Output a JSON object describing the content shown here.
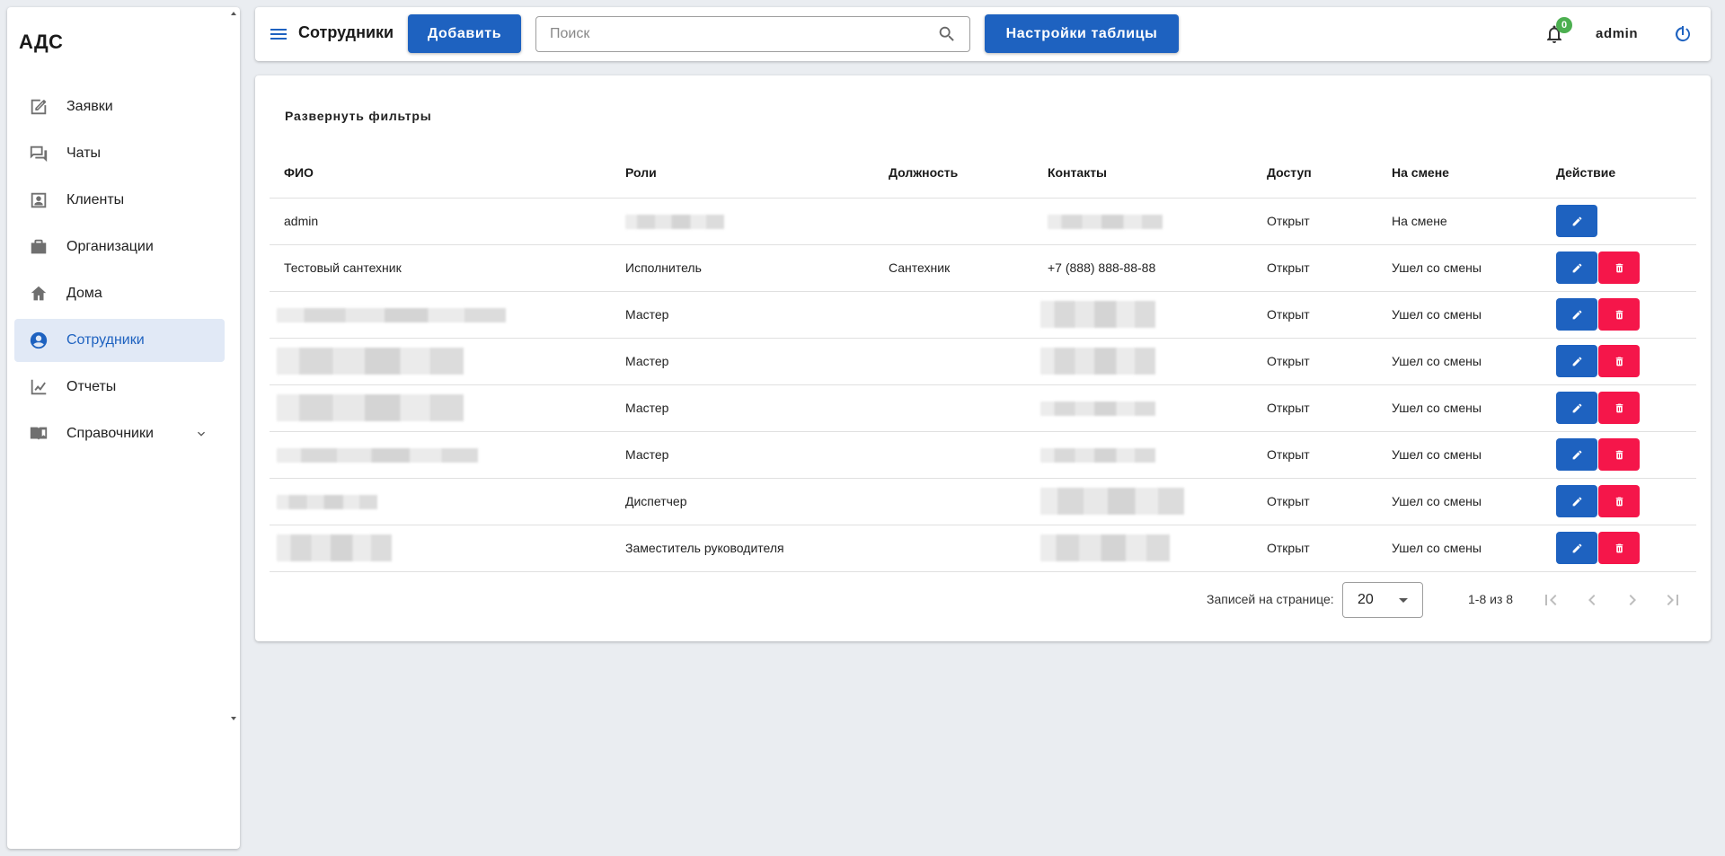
{
  "app": {
    "title": "АДС"
  },
  "sidebar": {
    "items": [
      {
        "label": "Заявки",
        "icon": "edit-note-icon",
        "active": false
      },
      {
        "label": "Чаты",
        "icon": "chat-icon",
        "active": false
      },
      {
        "label": "Клиенты",
        "icon": "contact-card-icon",
        "active": false
      },
      {
        "label": "Организации",
        "icon": "briefcase-icon",
        "active": false
      },
      {
        "label": "Дома",
        "icon": "home-icon",
        "active": false
      },
      {
        "label": "Сотрудники",
        "icon": "account-circle-icon",
        "active": true
      },
      {
        "label": "Отчеты",
        "icon": "line-chart-icon",
        "active": false
      },
      {
        "label": "Справочники",
        "icon": "book-icon",
        "active": false,
        "expandable": true
      }
    ]
  },
  "header": {
    "title": "Сотрудники",
    "add_label": "Добавить",
    "search_placeholder": "Поиск",
    "search_value": "",
    "table_settings_label": "Настройки таблицы",
    "notifications_count": "0",
    "user": "admin"
  },
  "filters": {
    "toggle_label": "Развернуть фильтры"
  },
  "table": {
    "columns": [
      "ФИО",
      "Роли",
      "Должность",
      "Контакты",
      "Доступ",
      "На смене",
      "Действие"
    ],
    "rows": [
      {
        "name": "admin",
        "role": "",
        "position": "",
        "contact": "",
        "access": "Открыт",
        "shift": "На смене",
        "deletable": false
      },
      {
        "name": "Тестовый сантехник",
        "role": "Исполнитель",
        "position": "Сантехник",
        "contact": "+7 (888) 888-88-88",
        "access": "Открыт",
        "shift": "Ушел со смены",
        "deletable": true
      },
      {
        "name": "",
        "role": "Мастер",
        "position": "",
        "contact": "",
        "access": "Открыт",
        "shift": "Ушел со смены",
        "deletable": true
      },
      {
        "name": "",
        "role": "Мастер",
        "position": "",
        "contact": "",
        "access": "Открыт",
        "shift": "Ушел со смены",
        "deletable": true
      },
      {
        "name": "",
        "role": "Мастер",
        "position": "",
        "contact": "",
        "access": "Открыт",
        "shift": "Ушел со смены",
        "deletable": true
      },
      {
        "name": "",
        "role": "Мастер",
        "position": "",
        "contact": "",
        "access": "Открыт",
        "shift": "Ушел со смены",
        "deletable": true
      },
      {
        "name": "",
        "role": "Диспетчер",
        "position": "",
        "contact": "",
        "access": "Открыт",
        "shift": "Ушел со смены",
        "deletable": true
      },
      {
        "name": "",
        "role": "Заместитель руководителя",
        "position": "",
        "contact": "",
        "access": "Открыт",
        "shift": "Ушел со смены",
        "deletable": true
      }
    ]
  },
  "pagination": {
    "per_page_label": "Записей на странице:",
    "per_page_value": "20",
    "range": "1-8 из 8"
  },
  "colors": {
    "primary": "#1e62c0",
    "danger": "#f5164a",
    "badge": "#4caf50",
    "active_bg": "#e1e9f6",
    "page_bg": "#eaedf1"
  }
}
